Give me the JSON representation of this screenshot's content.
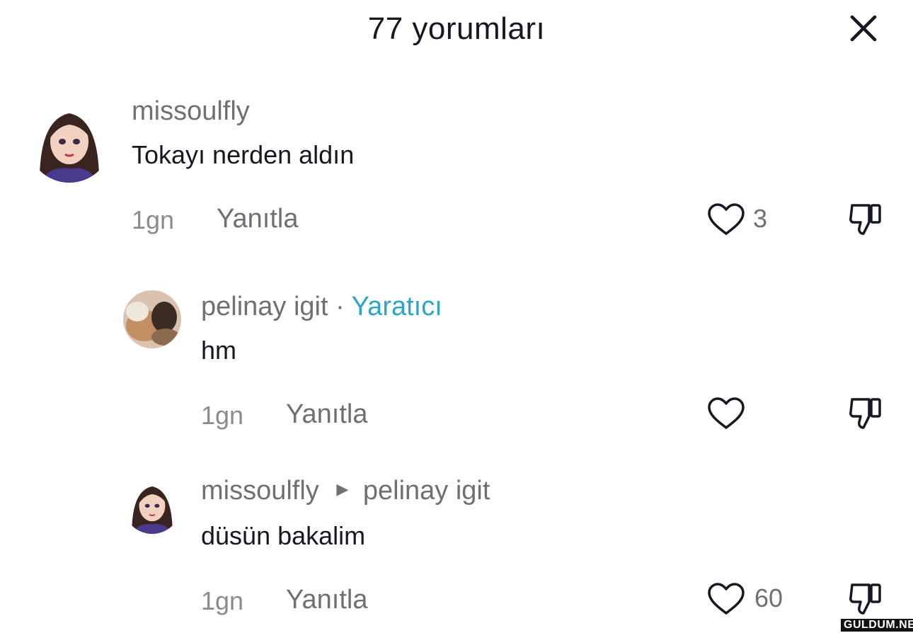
{
  "header": {
    "title": "77 yorumları"
  },
  "comments": [
    {
      "username": "missoulfly",
      "text": "Tokayı nerden aldın",
      "time": "1gn",
      "reply_label": "Yanıtla",
      "likes": "3"
    },
    {
      "username": "pelinay igit",
      "separator": "·",
      "badge": "Yaratıcı",
      "text": "hm",
      "time": "1gn",
      "reply_label": "Yanıtla"
    },
    {
      "username": "missoulfly",
      "reply_to": "pelinay igit",
      "text": "düsün bakalim",
      "time": "1gn",
      "reply_label": "Yanıtla",
      "likes": "60"
    }
  ],
  "watermark": "GULDUM.NET",
  "colors": {
    "creator_badge": "#2ba6c9",
    "text_primary": "#161823",
    "text_secondary": "#6f7075"
  },
  "icons": [
    "close-icon",
    "heart-icon",
    "thumbs-down-icon",
    "caret-right-icon"
  ]
}
